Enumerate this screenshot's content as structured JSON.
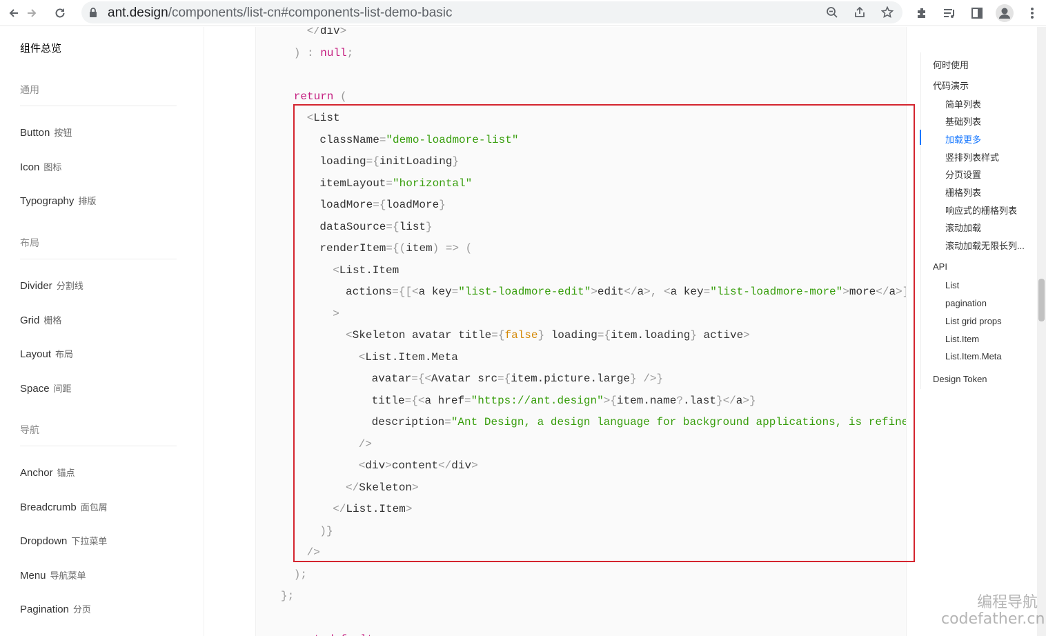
{
  "browser": {
    "url_host": "ant.design",
    "url_path": "/components/list-cn#components-list-demo-basic",
    "icons": [
      "back-icon",
      "forward-icon",
      "reload-icon",
      "lock-icon",
      "zoom-icon",
      "share-icon",
      "star-icon",
      "extensions-icon",
      "reading-list-icon",
      "sidepanel-icon",
      "profile-icon",
      "menu-icon"
    ]
  },
  "sidebar": {
    "title": "组件总览",
    "groups": [
      {
        "label": "通用",
        "items": [
          {
            "en": "Button",
            "cn": "按钮"
          },
          {
            "en": "Icon",
            "cn": "图标"
          },
          {
            "en": "Typography",
            "cn": "排版"
          }
        ]
      },
      {
        "label": "布局",
        "items": [
          {
            "en": "Divider",
            "cn": "分割线"
          },
          {
            "en": "Grid",
            "cn": "栅格"
          },
          {
            "en": "Layout",
            "cn": "布局"
          },
          {
            "en": "Space",
            "cn": "间距"
          }
        ]
      },
      {
        "label": "导航",
        "items": [
          {
            "en": "Anchor",
            "cn": "锚点"
          },
          {
            "en": "Breadcrumb",
            "cn": "面包屑"
          },
          {
            "en": "Dropdown",
            "cn": "下拉菜单"
          },
          {
            "en": "Menu",
            "cn": "导航菜单"
          },
          {
            "en": "Pagination",
            "cn": "分页"
          }
        ]
      }
    ]
  },
  "code": {
    "lines": [
      "    </div>",
      "  ) : null;",
      "",
      "  return (",
      "    <List",
      "      className=\"demo-loadmore-list\"",
      "      loading={initLoading}",
      "      itemLayout=\"horizontal\"",
      "      loadMore={loadMore}",
      "      dataSource={list}",
      "      renderItem={(item) => (",
      "        <List.Item",
      "          actions={[<a key=\"list-loadmore-edit\">edit</a>, <a key=\"list-loadmore-more\">more</a>]}",
      "        >",
      "          <Skeleton avatar title={false} loading={item.loading} active>",
      "            <List.Item.Meta",
      "              avatar={<Avatar src={item.picture.large} />}",
      "              title={<a href=\"https://ant.design\">{item.name?.last}</a>}",
      "              description=\"Ant Design, a design language for background applications, is refined",
      "            />",
      "            <div>content</div>",
      "          </Skeleton>",
      "        </List.Item>",
      "      )}",
      "    />",
      "  );",
      "};",
      "",
      "export default"
    ]
  },
  "toc": {
    "items": [
      {
        "label": "何时使用",
        "level": 1,
        "active": false
      },
      {
        "label": "代码演示",
        "level": 1,
        "active": false
      },
      {
        "label": "简单列表",
        "level": 2,
        "active": false
      },
      {
        "label": "基础列表",
        "level": 2,
        "active": false
      },
      {
        "label": "加载更多",
        "level": 2,
        "active": true
      },
      {
        "label": "竖排列表样式",
        "level": 2,
        "active": false
      },
      {
        "label": "分页设置",
        "level": 2,
        "active": false
      },
      {
        "label": "栅格列表",
        "level": 2,
        "active": false
      },
      {
        "label": "响应式的栅格列表",
        "level": 2,
        "active": false
      },
      {
        "label": "滚动加载",
        "level": 2,
        "active": false
      },
      {
        "label": "滚动加载无限长列...",
        "level": 2,
        "active": false
      },
      {
        "label": "API",
        "level": 1,
        "active": false
      },
      {
        "label": "List",
        "level": 2,
        "active": false
      },
      {
        "label": "pagination",
        "level": 2,
        "active": false
      },
      {
        "label": "List grid props",
        "level": 2,
        "active": false
      },
      {
        "label": "List.Item",
        "level": 2,
        "active": false
      },
      {
        "label": "List.Item.Meta",
        "level": 2,
        "active": false
      },
      {
        "label": "Design Token",
        "level": 1,
        "active": false
      }
    ]
  },
  "watermark": {
    "line1": "编程导航",
    "line2": "codefather.cn"
  },
  "colors": {
    "accent": "#1677ff",
    "highlight_border": "#d4242e",
    "code_string": "#389e0d",
    "code_keyword": "#c41d7f"
  }
}
